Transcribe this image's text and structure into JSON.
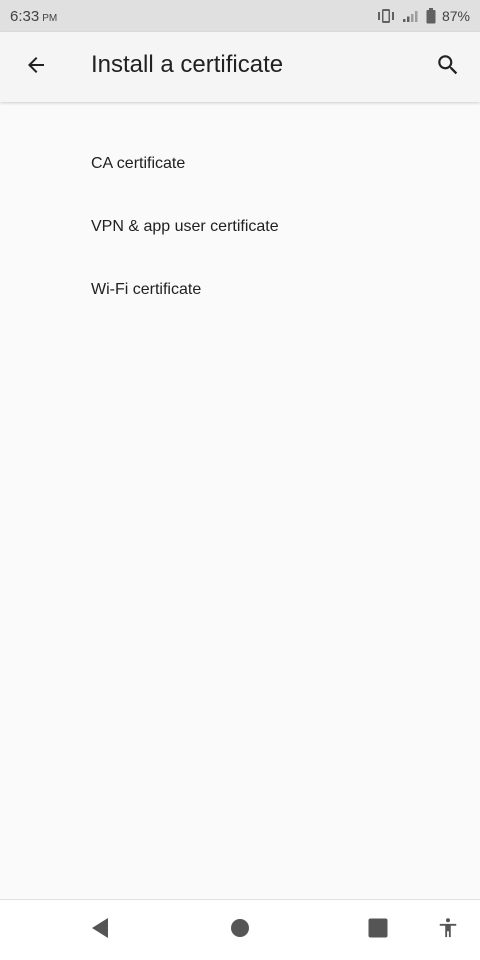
{
  "status_bar": {
    "time": "6:33",
    "ampm": "PM",
    "battery_percent": "87%",
    "icons": [
      "vibrate-icon",
      "signal-icon",
      "battery-icon"
    ]
  },
  "app_bar": {
    "title": "Install a certificate",
    "back_icon": "arrow-back-icon",
    "search_icon": "search-icon"
  },
  "list": {
    "items": [
      {
        "label": "CA certificate"
      },
      {
        "label": "VPN & app user certificate"
      },
      {
        "label": "Wi-Fi certificate"
      }
    ]
  },
  "nav_bar": {
    "icons": [
      "back-triangle-icon",
      "home-circle-icon",
      "recents-square-icon",
      "accessibility-icon"
    ]
  },
  "colors": {
    "background": "#fafafa",
    "status_bar": "#e0e0e0",
    "app_bar": "#f5f5f5",
    "text_primary": "#212121",
    "nav_icon": "#555555"
  }
}
